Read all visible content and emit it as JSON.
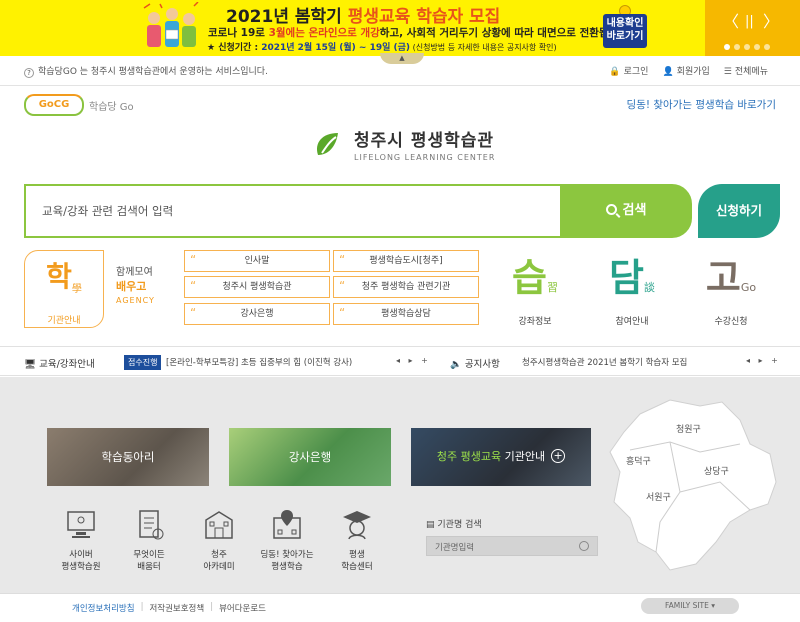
{
  "banner": {
    "title_pre": "2021년 봄학기 ",
    "title_hl": "평생교육 학습자 모집",
    "line2_pre": "코로나 19로 ",
    "line2_red": "3월에는 온라인으로 개강",
    "line2_post": "하고, 사회적 거리두기 상황에 따라 대면으로 전환됩니다.",
    "line3_pre": "★ 신청기간 : ",
    "line3_blue": "2021년 2월 15일 (월) ~ 19일 (금)",
    "line3_small": " (신청방법 등 자세한 내용은 공지사항 확인)",
    "cta": "내용확인\n바로가기",
    "prev": "〈",
    "pause": "||",
    "next": "〉",
    "colors": {
      "bg": "#fff200",
      "accent": "#e8541a",
      "cta": "#1d3d8f"
    }
  },
  "topbar": {
    "info": "학습당GO 는 청주시 평생학습관에서 운영하는 서비스입니다.",
    "login": "로그인",
    "signup": "회원가입",
    "allmenu": "전체메뉴"
  },
  "header": {
    "logo_mark": "GoCG",
    "logo_name": "학습당 Go",
    "dingdong": "딩동! 찾아가는 평생학습 바로가기",
    "center_ko": "청주시 평생학습관",
    "center_en": "LIFELONG LEARNING CENTER"
  },
  "search": {
    "placeholder": "교육/강좌 관련 검색어 입력",
    "button": "검색",
    "apply": "신청하기"
  },
  "agency": {
    "char": "학",
    "hanja": "學",
    "label": "기관안내",
    "l1": "함께모여",
    "l2": "배우고",
    "l3": "AGENCY",
    "buttons": [
      "인사말",
      "평생학습도시[청주]",
      "청주시 평생학습관",
      "청주 평생학습 관련기관",
      "강사은행",
      "평생학습상담"
    ]
  },
  "menus": [
    {
      "char": "습",
      "sub": "習",
      "label": "강좌정보",
      "color": "#8cc63f"
    },
    {
      "char": "담",
      "sub": "談",
      "label": "참여안내",
      "color": "#26a08a"
    },
    {
      "char": "고",
      "sub": "Go",
      "label": "수강신청",
      "color": "#7a6d63"
    }
  ],
  "ticker": {
    "label1": "교육/강좌안내",
    "badge": "접수진행",
    "news1": "[온라인-학부모특강] 초등 집중부의 힘 (이진혁 강사)",
    "arrows": "◂ ▸ +",
    "label2": "공지사항",
    "news2": "청주시평생학습관 2021년 봄학기 학습자 모집"
  },
  "tiles": {
    "t1": "학습동아리",
    "t2": "강사은행",
    "t3_green": "청주 평생교육",
    "t3_rest": " 기관안내",
    "t3_plus": "+"
  },
  "quicklinks": [
    {
      "l1": "사이버",
      "l2": "평생학습원"
    },
    {
      "l1": "무엇이든",
      "l2": "배움터"
    },
    {
      "l1": "청주",
      "l2": "아카데미"
    },
    {
      "l1": "딩동! 찾아가는",
      "l2": "평생학습"
    },
    {
      "l1": "평생",
      "l2": "학습센터"
    }
  ],
  "inst_search": {
    "label": "기관명 검색",
    "placeholder": "기관명입력"
  },
  "map": {
    "districts": [
      "청원구",
      "흥덕구",
      "상당구",
      "서원구"
    ]
  },
  "footer": {
    "privacy": "개인정보처리방침",
    "copyright": "저작권보호정책",
    "viewer": "뷰어다운로드",
    "family": "FAMILY SITE ▾"
  }
}
